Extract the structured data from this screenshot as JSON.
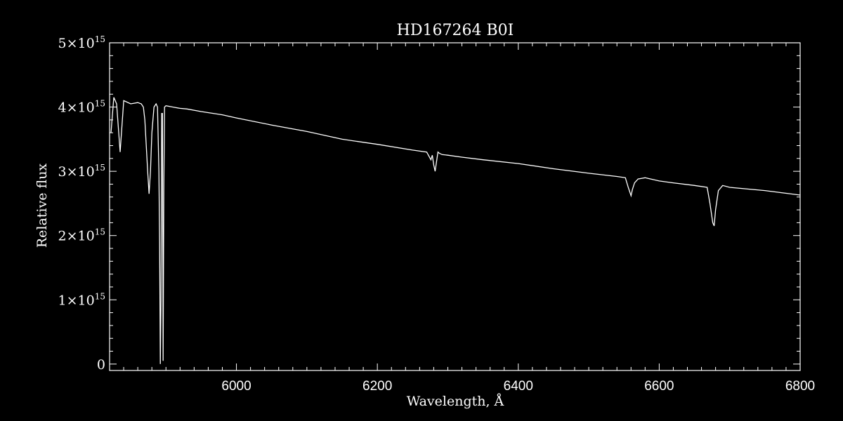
{
  "chart_data": {
    "type": "line",
    "title": "HD167264  B0I",
    "xlabel": "Wavelength, Å",
    "ylabel": "Relative flux",
    "xlim": [
      5820,
      6800
    ],
    "ylim": [
      -100000000000000.0,
      5000000000000000.0
    ],
    "x_ticks": [
      6000,
      6200,
      6400,
      6600,
      6800
    ],
    "y_ticks": [
      {
        "value": 0,
        "label": "0",
        "exp": ""
      },
      {
        "value": 1000000000000000.0,
        "label": "1×10",
        "exp": "15"
      },
      {
        "value": 2000000000000000.0,
        "label": "2×10",
        "exp": "15"
      },
      {
        "value": 3000000000000000.0,
        "label": "3×10",
        "exp": "15"
      },
      {
        "value": 4000000000000000.0,
        "label": "4×10",
        "exp": "15"
      },
      {
        "value": 5000000000000000.0,
        "label": "5×10",
        "exp": "15"
      }
    ],
    "grid": false,
    "colors": {
      "background": "#000000",
      "foreground": "#ffffff"
    },
    "series": [
      {
        "x": [
          5822,
          5826,
          5830,
          5835,
          5840,
          5850,
          5860,
          5865,
          5868,
          5870,
          5872,
          5874,
          5876,
          5878,
          5880,
          5883,
          5886,
          5888,
          5890,
          5891,
          5892,
          5893,
          5894,
          5895,
          5896,
          5897,
          5898,
          5900,
          5910,
          5920,
          5930,
          5950,
          5980,
          6000,
          6050,
          6100,
          6150,
          6200,
          6250,
          6270,
          6276,
          6278,
          6280,
          6282,
          6284,
          6286,
          6288,
          6292,
          6300,
          6320,
          6350,
          6400,
          6450,
          6500,
          6540,
          6552,
          6556,
          6560,
          6562,
          6565,
          6570,
          6580,
          6600,
          6620,
          6650,
          6668,
          6672,
          6676,
          6678,
          6680,
          6684,
          6690,
          6700,
          6750,
          6800
        ],
        "y": [
          3600000000000000.0,
          4150000000000000.0,
          4050000000000000.0,
          3300000000000000.0,
          4100000000000000.0,
          4050000000000000.0,
          4070000000000000.0,
          4050000000000000.0,
          4000000000000000.0,
          3800000000000000.0,
          3400000000000000.0,
          3000000000000000.0,
          2650000000000000.0,
          3000000000000000.0,
          3600000000000000.0,
          4000000000000000.0,
          4050000000000000.0,
          4000000000000000.0,
          3000000000000000.0,
          1900000000000000.0,
          0.0,
          1000000000000000.0,
          3900000000000000.0,
          3900000000000000.0,
          50000000000000.0,
          2700000000000000.0,
          4000000000000000.0,
          4020000000000000.0,
          4000000000000000.0,
          3980000000000000.0,
          3970000000000000.0,
          3930000000000000.0,
          3880000000000000.0,
          3830000000000000.0,
          3720000000000000.0,
          3620000000000000.0,
          3500000000000000.0,
          3420000000000000.0,
          3330000000000000.0,
          3300000000000000.0,
          3180000000000000.0,
          3250000000000000.0,
          3100000000000000.0,
          3000000000000000.0,
          3150000000000000.0,
          3300000000000000.0,
          3280000000000000.0,
          3260000000000000.0,
          3250000000000000.0,
          3220000000000000.0,
          3180000000000000.0,
          3120000000000000.0,
          3040000000000000.0,
          2970000000000000.0,
          2920000000000000.0,
          2900000000000000.0,
          2750000000000000.0,
          2620000000000000.0,
          2720000000000000.0,
          2820000000000000.0,
          2880000000000000.0,
          2900000000000000.0,
          2850000000000000.0,
          2820000000000000.0,
          2780000000000000.0,
          2750000000000000.0,
          2500000000000000.0,
          2200000000000000.0,
          2150000000000000.0,
          2400000000000000.0,
          2700000000000000.0,
          2780000000000000.0,
          2750000000000000.0,
          2700000000000000.0,
          2630000000000000.0
        ]
      }
    ]
  }
}
